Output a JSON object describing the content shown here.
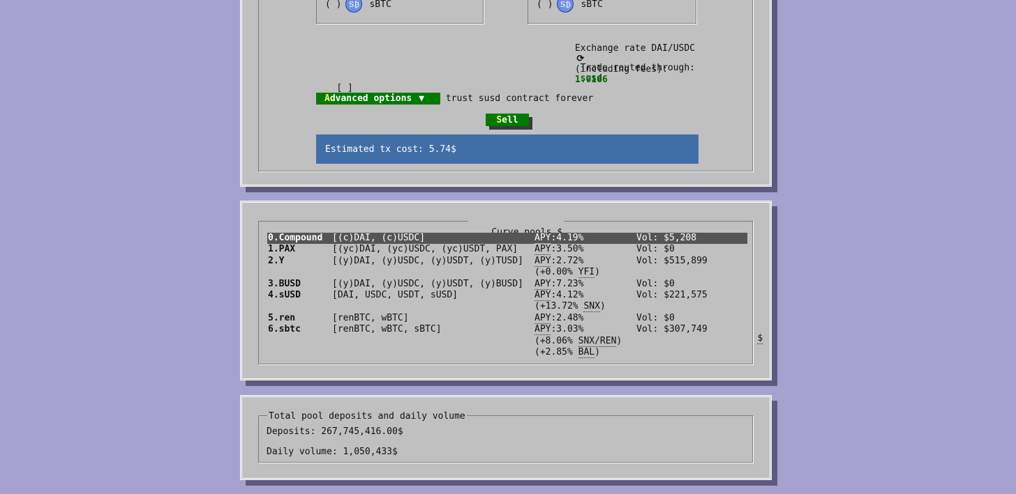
{
  "swap": {
    "from_coin": {
      "radio": "( )",
      "icon": "sbtc-icon",
      "label": "sBTC"
    },
    "to_coin": {
      "radio": "( )",
      "icon": "sbtc-icon",
      "label": "sBTC"
    },
    "coin_icon_glyph": "S₿",
    "exchange_rate_label": "Exchange rate DAI/USDC",
    "exchange_rate_suffix": "(including fees):",
    "exchange_rate_value": "1.0166",
    "route_label": "Trade routed through:",
    "route_value": "susd",
    "infinite_approval_checkbox": "[ ]",
    "infinite_approval_label": "Infinite approval - trust susd contract forever",
    "advanced_hotkey": "A",
    "advanced_rest": "dvanced options",
    "advanced_arrow": "▼",
    "sell_hotkey": "S",
    "sell_rest": "ell",
    "tx_cost": "Estimated tx cost: 5.74$"
  },
  "pools": {
    "title": "Curve pools",
    "title_currency": "$",
    "side_currency": "$",
    "rows": [
      {
        "name": "0.Compound",
        "coins": "[(c)DAI, (c)USDC]",
        "apy_label": "APY",
        "apy": ":4.19%",
        "vol": "Vol: $5,208",
        "extras": []
      },
      {
        "name": "1.PAX",
        "coins": "[(yc)DAI, (yc)USDC, (yc)USDT, PAX]",
        "apy_label": "APY",
        "apy": ":3.50%",
        "vol": "Vol: $0",
        "extras": []
      },
      {
        "name": "2.Y",
        "coins": "[(y)DAI, (y)USDC, (y)USDT, (y)TUSD]",
        "apy_label": "APY",
        "apy": ":2.72%",
        "vol": "Vol: $515,899",
        "extras": [
          {
            "pre": "(+0.00% ",
            "token": "YFI",
            "post": ")"
          }
        ]
      },
      {
        "name": "3.BUSD",
        "coins": "[(y)DAI, (y)USDC, (y)USDT, (y)BUSD]",
        "apy_label": "APY",
        "apy": ":7.23%",
        "vol": "Vol: $0",
        "extras": []
      },
      {
        "name": "4.sUSD",
        "coins": "[DAI, USDC, USDT, sUSD]",
        "apy_label": "APY",
        "apy": ":4.12%",
        "vol": "Vol: $221,575",
        "extras": [
          {
            "pre": "(+13.72% ",
            "token": "SNX",
            "post": ")"
          }
        ]
      },
      {
        "name": "5.ren",
        "coins": "[renBTC, wBTC]",
        "apy_label": "APY",
        "apy": ":2.48%",
        "vol": "Vol: $0",
        "extras": []
      },
      {
        "name": "6.sbtc",
        "coins": "[renBTC, wBTC, sBTC]",
        "apy_label": "APY",
        "apy": ":3.03%",
        "vol": "Vol: $307,749",
        "extras": [
          {
            "pre": "(+8.06% ",
            "token": "SNX/REN",
            "post": ")"
          },
          {
            "pre": "(+2.85% ",
            "token": "BAL",
            "post": ")"
          }
        ]
      }
    ]
  },
  "totals": {
    "title": "Total pool deposits and daily volume",
    "deposits": "Deposits: 267,745,416.00$",
    "daily_volume": "Daily volume: 1,050,433$"
  },
  "colors": {
    "background": "#a5a2cf",
    "panel": "#c0c0c0",
    "button_green": "#007a00",
    "hotkey_yellow": "#ffff55",
    "tx_blue": "#426ea8",
    "value_green": "#006400",
    "selected_row": "#555555"
  }
}
